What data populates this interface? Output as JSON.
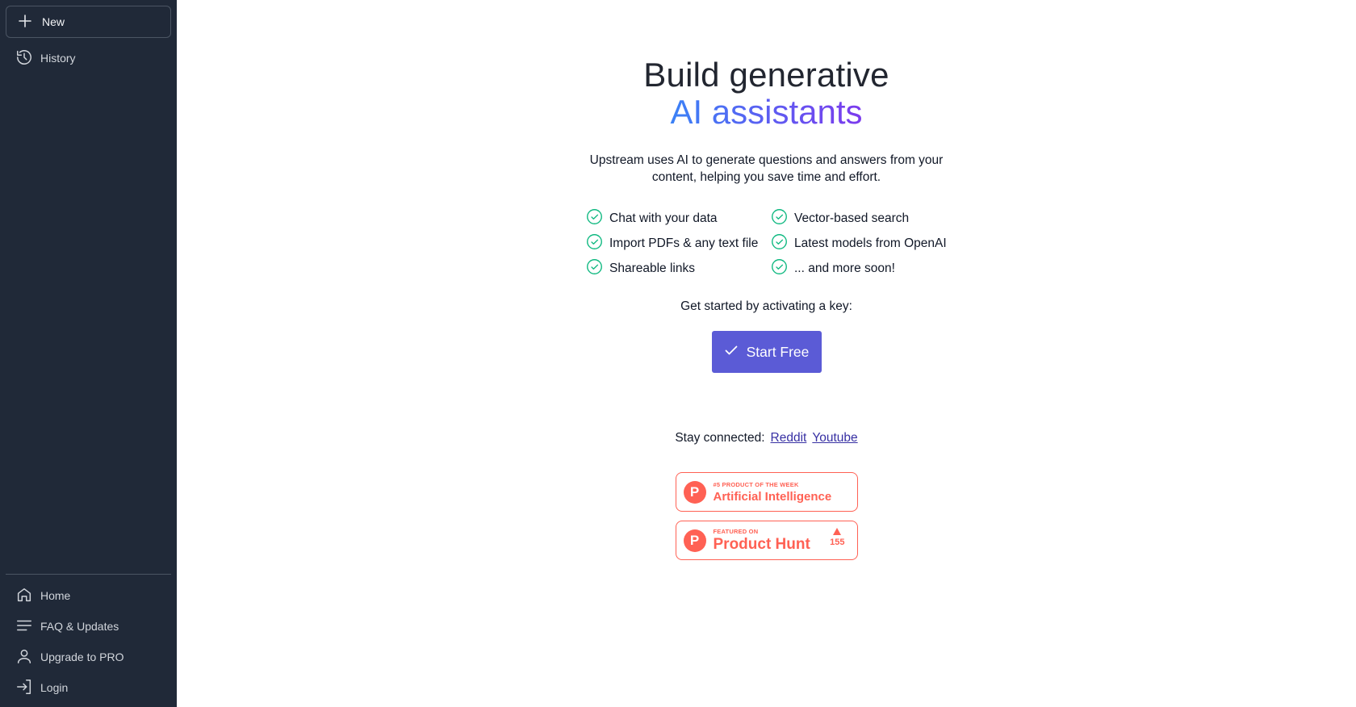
{
  "sidebar": {
    "new_label": "New",
    "history_label": "History",
    "bottom_items": [
      {
        "label": "Home",
        "icon": "home-icon"
      },
      {
        "label": "FAQ & Updates",
        "icon": "menu-lines-icon"
      },
      {
        "label": "Upgrade to PRO",
        "icon": "user-icon"
      },
      {
        "label": "Login",
        "icon": "login-icon"
      }
    ]
  },
  "hero": {
    "title_line1": "Build generative",
    "title_line2": "AI assistants",
    "subtitle": "Upstream uses AI to generate questions and answers from your content, helping you save time and effort."
  },
  "features": [
    "Chat with your data",
    "Vector-based search",
    "Import PDFs & any text file",
    "Latest models from OpenAI",
    "Shareable links",
    "... and more soon!"
  ],
  "cta": {
    "prompt": "Get started by activating a key:",
    "button_label": "Start Free"
  },
  "social": {
    "label": "Stay connected:",
    "links": [
      "Reddit",
      "Youtube"
    ]
  },
  "badges": {
    "week": {
      "small": "#5 PRODUCT OF THE WEEK",
      "big": "Artificial Intelligence",
      "logo": "P"
    },
    "featured": {
      "small": "FEATURED ON",
      "big": "Product Hunt",
      "logo": "P",
      "votes": "155"
    }
  },
  "colors": {
    "sidebar_bg": "#202938",
    "accent": "#5b5bd6",
    "check": "#10b981",
    "product_hunt": "#ff6154"
  }
}
